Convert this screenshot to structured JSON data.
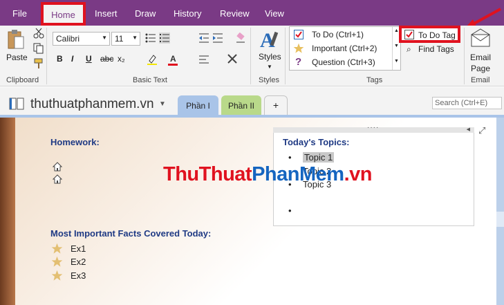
{
  "menu": {
    "items": [
      "File",
      "Home",
      "Insert",
      "Draw",
      "History",
      "Review",
      "View"
    ],
    "active": "Home"
  },
  "ribbon": {
    "clipboard": {
      "paste_label": "Paste",
      "group_label": "Clipboard"
    },
    "basic_text": {
      "font_name": "Calibri",
      "font_size": "11",
      "bold": "B",
      "italic": "I",
      "underline": "U",
      "strikethrough": "abc",
      "subscript": "x₂",
      "font_color": "A",
      "group_label": "Basic Text"
    },
    "styles": {
      "label": "Styles",
      "group_label": "Styles"
    },
    "tags": {
      "items": [
        {
          "label": "To Do (Ctrl+1)",
          "icon": "checkbox-icon"
        },
        {
          "label": "Important (Ctrl+2)",
          "icon": "star-icon"
        },
        {
          "label": "Question (Ctrl+3)",
          "icon": "question-icon"
        }
      ],
      "todo_tag_label": "To Do Tag",
      "find_tags_label": "Find Tags",
      "group_label": "Tags"
    },
    "email": {
      "label_line1": "Email",
      "label_line2": "Page",
      "group_label": "Email"
    }
  },
  "notebook": {
    "title": "thuthuatphanmem.vn",
    "tabs": [
      {
        "label": "Phần I",
        "color": "#a9c4e8"
      },
      {
        "label": "Phần II",
        "color": "#b9d98a"
      },
      {
        "label": "+",
        "color": "#f3f3f3"
      }
    ],
    "search_placeholder": "Search (Ctrl+E)"
  },
  "page": {
    "homework_heading": "Homework:",
    "topics_heading": "Today's Topics:",
    "topics": [
      "Topic 1",
      "Topic 2",
      "Topic 3",
      ""
    ],
    "facts_heading": "Most Important Facts Covered Today:",
    "facts": [
      "Ex1",
      "Ex2",
      "Ex3"
    ],
    "watermark_part1": "ThuThuat",
    "watermark_part2": "PhanMem",
    "watermark_part3": ".vn"
  },
  "colors": {
    "accent": "#7a3a85",
    "highlight_red": "#e0121f",
    "heading_blue": "#1f3a84"
  }
}
